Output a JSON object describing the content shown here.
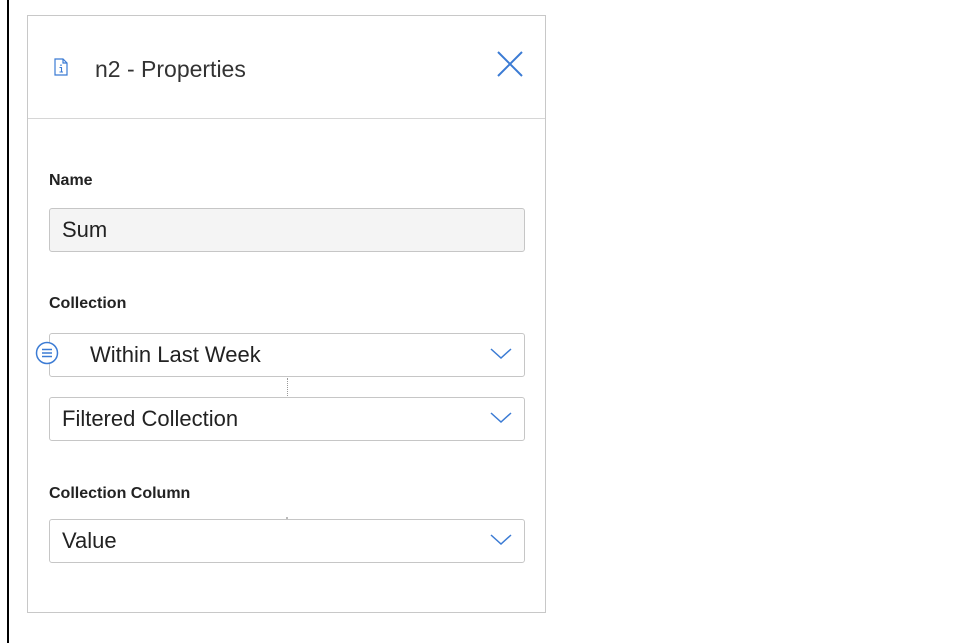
{
  "panel": {
    "title": "n2 - Properties",
    "header_icon": "info-document-icon",
    "close_icon": "close-icon"
  },
  "fields": {
    "name": {
      "label": "Name",
      "value": "Sum"
    },
    "collection": {
      "label": "Collection",
      "primary_value": "Within Last Week",
      "primary_icon": "list-icon",
      "secondary_value": "Filtered Collection"
    },
    "collection_column": {
      "label": "Collection Column",
      "value": "Value"
    }
  },
  "colors": {
    "accent": "#3b7bd4",
    "border": "#c6c6c6",
    "input_background": "#f4f4f4"
  }
}
